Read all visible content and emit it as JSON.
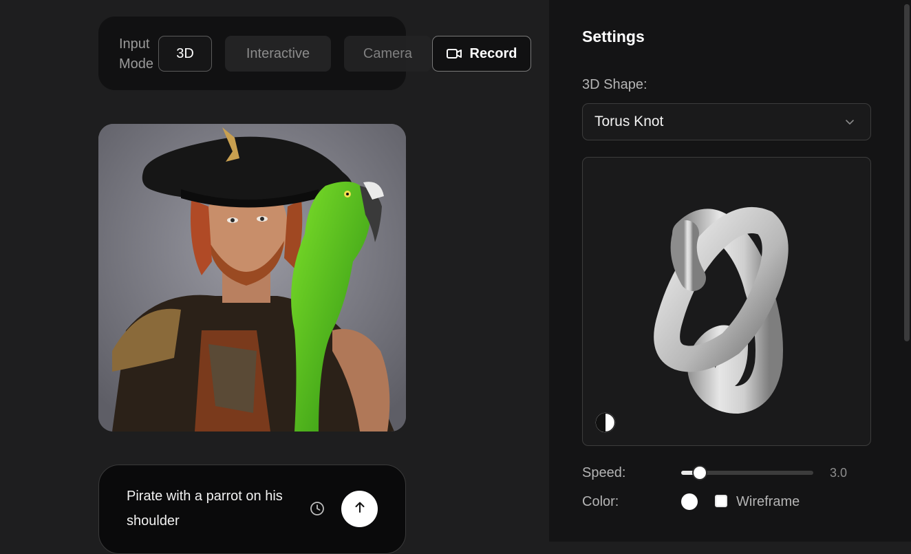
{
  "input_mode": {
    "label": "Input Mode",
    "buttons": [
      {
        "label": "3D",
        "state": "selected"
      },
      {
        "label": "Interactive",
        "state": "disabled"
      },
      {
        "label": "Camera",
        "state": "disabled"
      }
    ],
    "record_label": "Record",
    "record_icon": "video-camera-icon"
  },
  "image": {
    "subject": "pirate-with-parrot"
  },
  "prompt": {
    "text": "Pirate with a parrot on his shoulder",
    "history_icon": "clock-icon",
    "submit_icon": "arrow-up-icon"
  },
  "settings": {
    "title": "Settings",
    "shape_label": "3D Shape:",
    "shape_value": "Torus Knot",
    "dropdown_icon": "chevron-down-icon",
    "preview_toggle_icon": "contrast-icon",
    "speed_label": "Speed:",
    "speed_value": "3.0",
    "speed_fraction": 0.12,
    "color_label": "Color:",
    "color_value": "#ffffff",
    "wireframe_label": "Wireframe",
    "wireframe_checked": false
  },
  "colors": {
    "background": "#1e1e1f",
    "panel": "#141415",
    "accent": "#ffffff"
  }
}
